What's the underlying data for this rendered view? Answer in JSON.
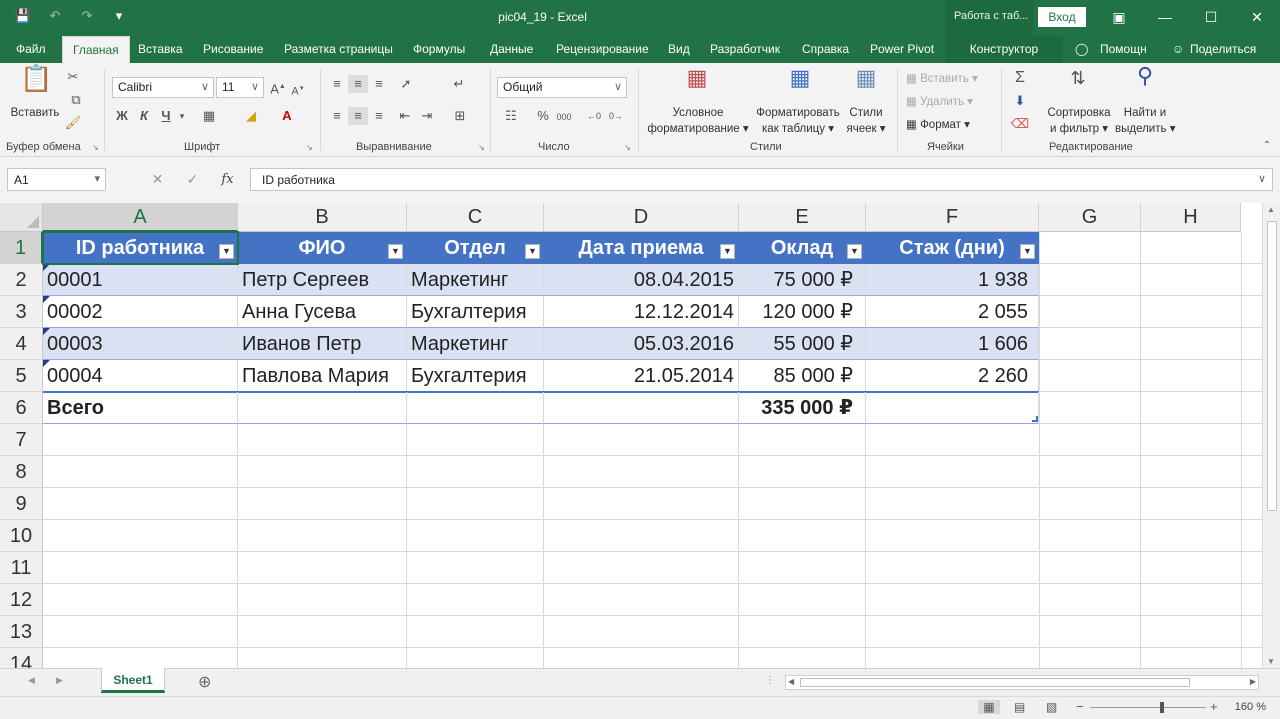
{
  "window": {
    "document_title": "pic04_19 - Excel",
    "context_label": "Работа с таб...",
    "signin_label": "Вход",
    "qat_icons": [
      "save-icon",
      "undo-icon",
      "redo-icon",
      "customize-icon"
    ]
  },
  "tabs": [
    "Файл",
    "Главная",
    "Вставка",
    "Рисование",
    "Разметка страницы",
    "Формулы",
    "Данные",
    "Рецензирование",
    "Вид",
    "Разработчик",
    "Справка",
    "Power Pivot"
  ],
  "active_tab": "Главная",
  "context_tab": "Конструктор",
  "help_tab": "Помощн",
  "share_tab": "Поделиться",
  "ribbon": {
    "clipboard": {
      "label": "Буфер обмена",
      "paste": "Вставить"
    },
    "font": {
      "label": "Шрифт",
      "font_name": "Calibri",
      "font_size": "11",
      "bold": "Ж",
      "italic": "К",
      "underline": "Ч"
    },
    "alignment": {
      "label": "Выравнивание"
    },
    "number": {
      "label": "Число",
      "format": "Общий",
      "percent": "%",
      "thousands": "000"
    },
    "styles": {
      "label": "Стили",
      "conditional": [
        "Условное",
        "форматирование"
      ],
      "as_table": [
        "Форматировать",
        "как таблицу"
      ],
      "cell_styles": [
        "Стили",
        "ячеек"
      ]
    },
    "cells": {
      "label": "Ячейки",
      "insert": "Вставить",
      "delete": "Удалить",
      "format": "Формат"
    },
    "editing": {
      "label": "Редактирование",
      "sort": [
        "Сортировка",
        "и фильтр"
      ],
      "find": [
        "Найти и",
        "выделить"
      ]
    }
  },
  "formula_bar": {
    "name_box": "A1",
    "fx": "fx",
    "content": "ID работника"
  },
  "columns": [
    "A",
    "B",
    "C",
    "D",
    "E",
    "F",
    "G",
    "H"
  ],
  "rows": [
    "1",
    "2",
    "3",
    "4",
    "5",
    "6",
    "7",
    "8",
    "9",
    "10",
    "11",
    "12",
    "13",
    "14"
  ],
  "table": {
    "headers": [
      "ID работника",
      "ФИО",
      "Отдел",
      "Дата приема",
      "Оклад",
      "Стаж (дни)"
    ],
    "rows": [
      [
        "00001",
        "Петр Сергеев",
        "Маркетинг",
        "08.04.2015",
        "75 000 ₽",
        "1 938"
      ],
      [
        "00002",
        "Анна Гусева",
        "Бухгалтерия",
        "12.12.2014",
        "120 000 ₽",
        "2 055"
      ],
      [
        "00003",
        "Иванов Петр",
        "Маркетинг",
        "05.03.2016",
        "55 000 ₽",
        "1 606"
      ],
      [
        "00004",
        "Павлова Мария",
        "Бухгалтерия",
        "21.05.2014",
        "85 000 ₽",
        "2 260"
      ]
    ],
    "total": [
      "Всего",
      "",
      "",
      "",
      "335 000 ₽",
      ""
    ]
  },
  "sheet_tab": "Sheet1",
  "zoom_level": "160 %"
}
